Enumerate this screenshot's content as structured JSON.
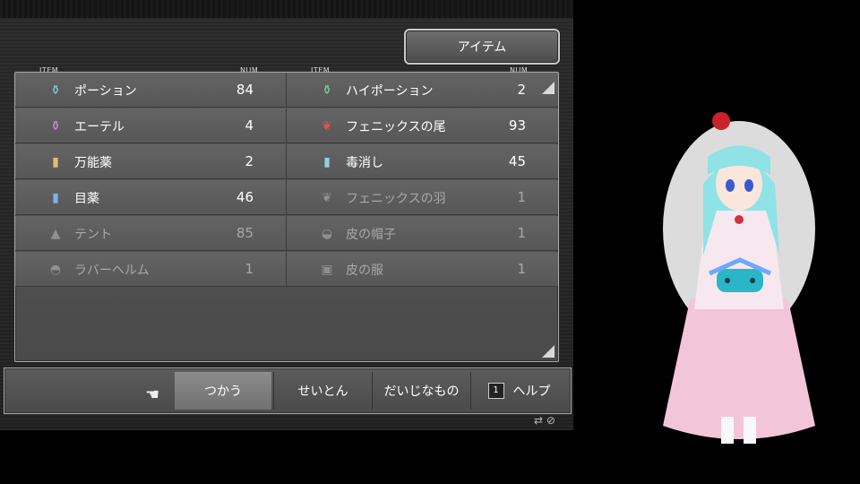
{
  "menu": {
    "title": "アイテム"
  },
  "columns": {
    "left_item": "ITEM",
    "left_num": "NUM",
    "right_item": "ITEM",
    "right_num": "NUM"
  },
  "items": [
    {
      "name": "ポーション",
      "num": "84",
      "icon": "potion-icon",
      "glyph": "⚱",
      "color": "#7fd0d8",
      "dim": false
    },
    {
      "name": "ハイポーション",
      "num": "2",
      "icon": "hi-potion-icon",
      "glyph": "⚱",
      "color": "#7fd0a0",
      "dim": false
    },
    {
      "name": "エーテル",
      "num": "4",
      "icon": "ether-icon",
      "glyph": "⚱",
      "color": "#d090e0",
      "dim": false
    },
    {
      "name": "フェニックスの尾",
      "num": "93",
      "icon": "phoenix-down-icon",
      "glyph": "❦",
      "color": "#e85050",
      "dim": false
    },
    {
      "name": "万能薬",
      "num": "2",
      "icon": "elixir-icon",
      "glyph": "▮",
      "color": "#e0c070",
      "dim": false
    },
    {
      "name": "毒消し",
      "num": "45",
      "icon": "antidote-icon",
      "glyph": "▮",
      "color": "#90d0e0",
      "dim": false
    },
    {
      "name": "目薬",
      "num": "46",
      "icon": "eye-drops-icon",
      "glyph": "▮",
      "color": "#80b0f0",
      "dim": false
    },
    {
      "name": "フェニックスの羽",
      "num": "1",
      "icon": "phoenix-feather-icon",
      "glyph": "❦",
      "color": "#bbbbbb",
      "dim": true
    },
    {
      "name": "テント",
      "num": "85",
      "icon": "tent-icon",
      "glyph": "▲",
      "color": "#bbbbbb",
      "dim": true
    },
    {
      "name": "皮の帽子",
      "num": "1",
      "icon": "leather-cap-icon",
      "glyph": "◒",
      "color": "#bbbbbb",
      "dim": true
    },
    {
      "name": "ラバーヘルム",
      "num": "1",
      "icon": "helmet-icon",
      "glyph": "◓",
      "color": "#bbbbbb",
      "dim": true
    },
    {
      "name": "皮の服",
      "num": "1",
      "icon": "leather-clothes-icon",
      "glyph": "▣",
      "color": "#bbbbbb",
      "dim": true
    }
  ],
  "commands": {
    "use": "つかう",
    "sort": "せいとん",
    "key_items": "だいじなもの",
    "help": "ヘルプ",
    "help_key": "1"
  }
}
